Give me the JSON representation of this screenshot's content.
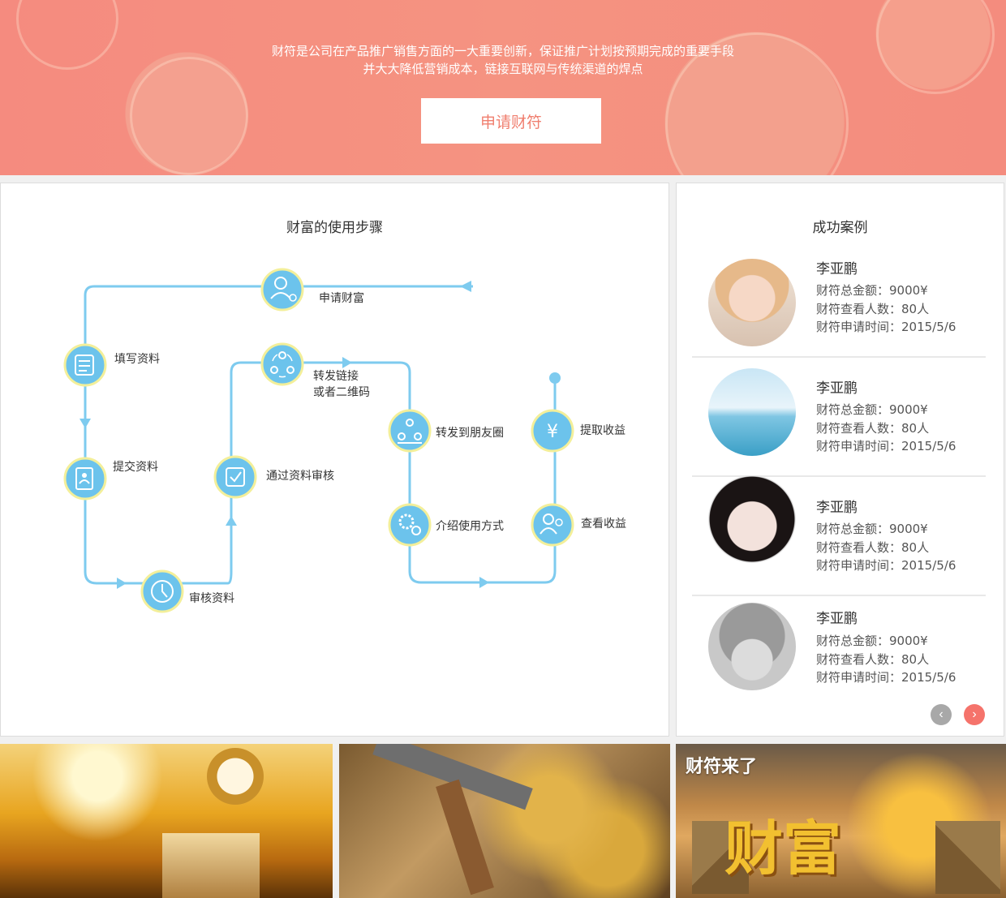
{
  "hero": {
    "line1": "财符是公司在产品推广销售方面的一大重要创新，保证推广计划按预期完成的重要手段",
    "line2": "并大大降低营销成本，链接互联网与传统渠道的焊点",
    "apply_button": "申请财符"
  },
  "steps_panel": {
    "title": "财富的使用步骤",
    "steps": [
      {
        "label": "申请财富",
        "icon": "user-gear-icon"
      },
      {
        "label": "填写资料",
        "icon": "form-edit-icon"
      },
      {
        "label": "提交资料",
        "icon": "document-user-icon"
      },
      {
        "label": "审核资料",
        "icon": "clock-icon"
      },
      {
        "label": "通过资料审核",
        "icon": "check-box-icon"
      },
      {
        "label": "转发链接\n或者二维码",
        "icon": "share-cycle-icon"
      },
      {
        "label": "转发到朋友圈",
        "icon": "group-share-icon"
      },
      {
        "label": "介绍使用方式",
        "icon": "gear-icon"
      },
      {
        "label": "查看收益",
        "icon": "users-icon"
      },
      {
        "label": "提取收益",
        "icon": "yen-icon"
      }
    ],
    "colors": {
      "line": "#7ecbef",
      "node": "#6cc3ec",
      "ring": "#f3ef9a"
    }
  },
  "cases_panel": {
    "title": "成功案例",
    "cases": [
      {
        "name": "李亚鹏",
        "total": "财符总金额：9000¥",
        "viewers": "财符查看人数：80人",
        "date": "财符申请时间：2015/5/6"
      },
      {
        "name": "李亚鹏",
        "total": "财符总金额：9000¥",
        "viewers": "财符查看人数：80人",
        "date": "财符申请时间：2015/5/6"
      },
      {
        "name": "李亚鹏",
        "total": "财符总金额：9000¥",
        "viewers": "财符查看人数：80人",
        "date": "财符申请时间：2015/5/6"
      },
      {
        "name": "李亚鹏",
        "total": "财符总金额：9000¥",
        "viewers": "财符查看人数：80人",
        "date": "财符申请时间：2015/5/6"
      }
    ],
    "prev_icon": "chevron-left-icon",
    "next_icon": "chevron-right-icon",
    "colors": {
      "prev": "#a8a8a8",
      "next": "#f5736b"
    }
  },
  "gallery": {
    "caption3": "财符来了",
    "big_text3": "财富"
  },
  "colors": {
    "hero_bg": "#f58b7f",
    "accent": "#f07f6f"
  }
}
